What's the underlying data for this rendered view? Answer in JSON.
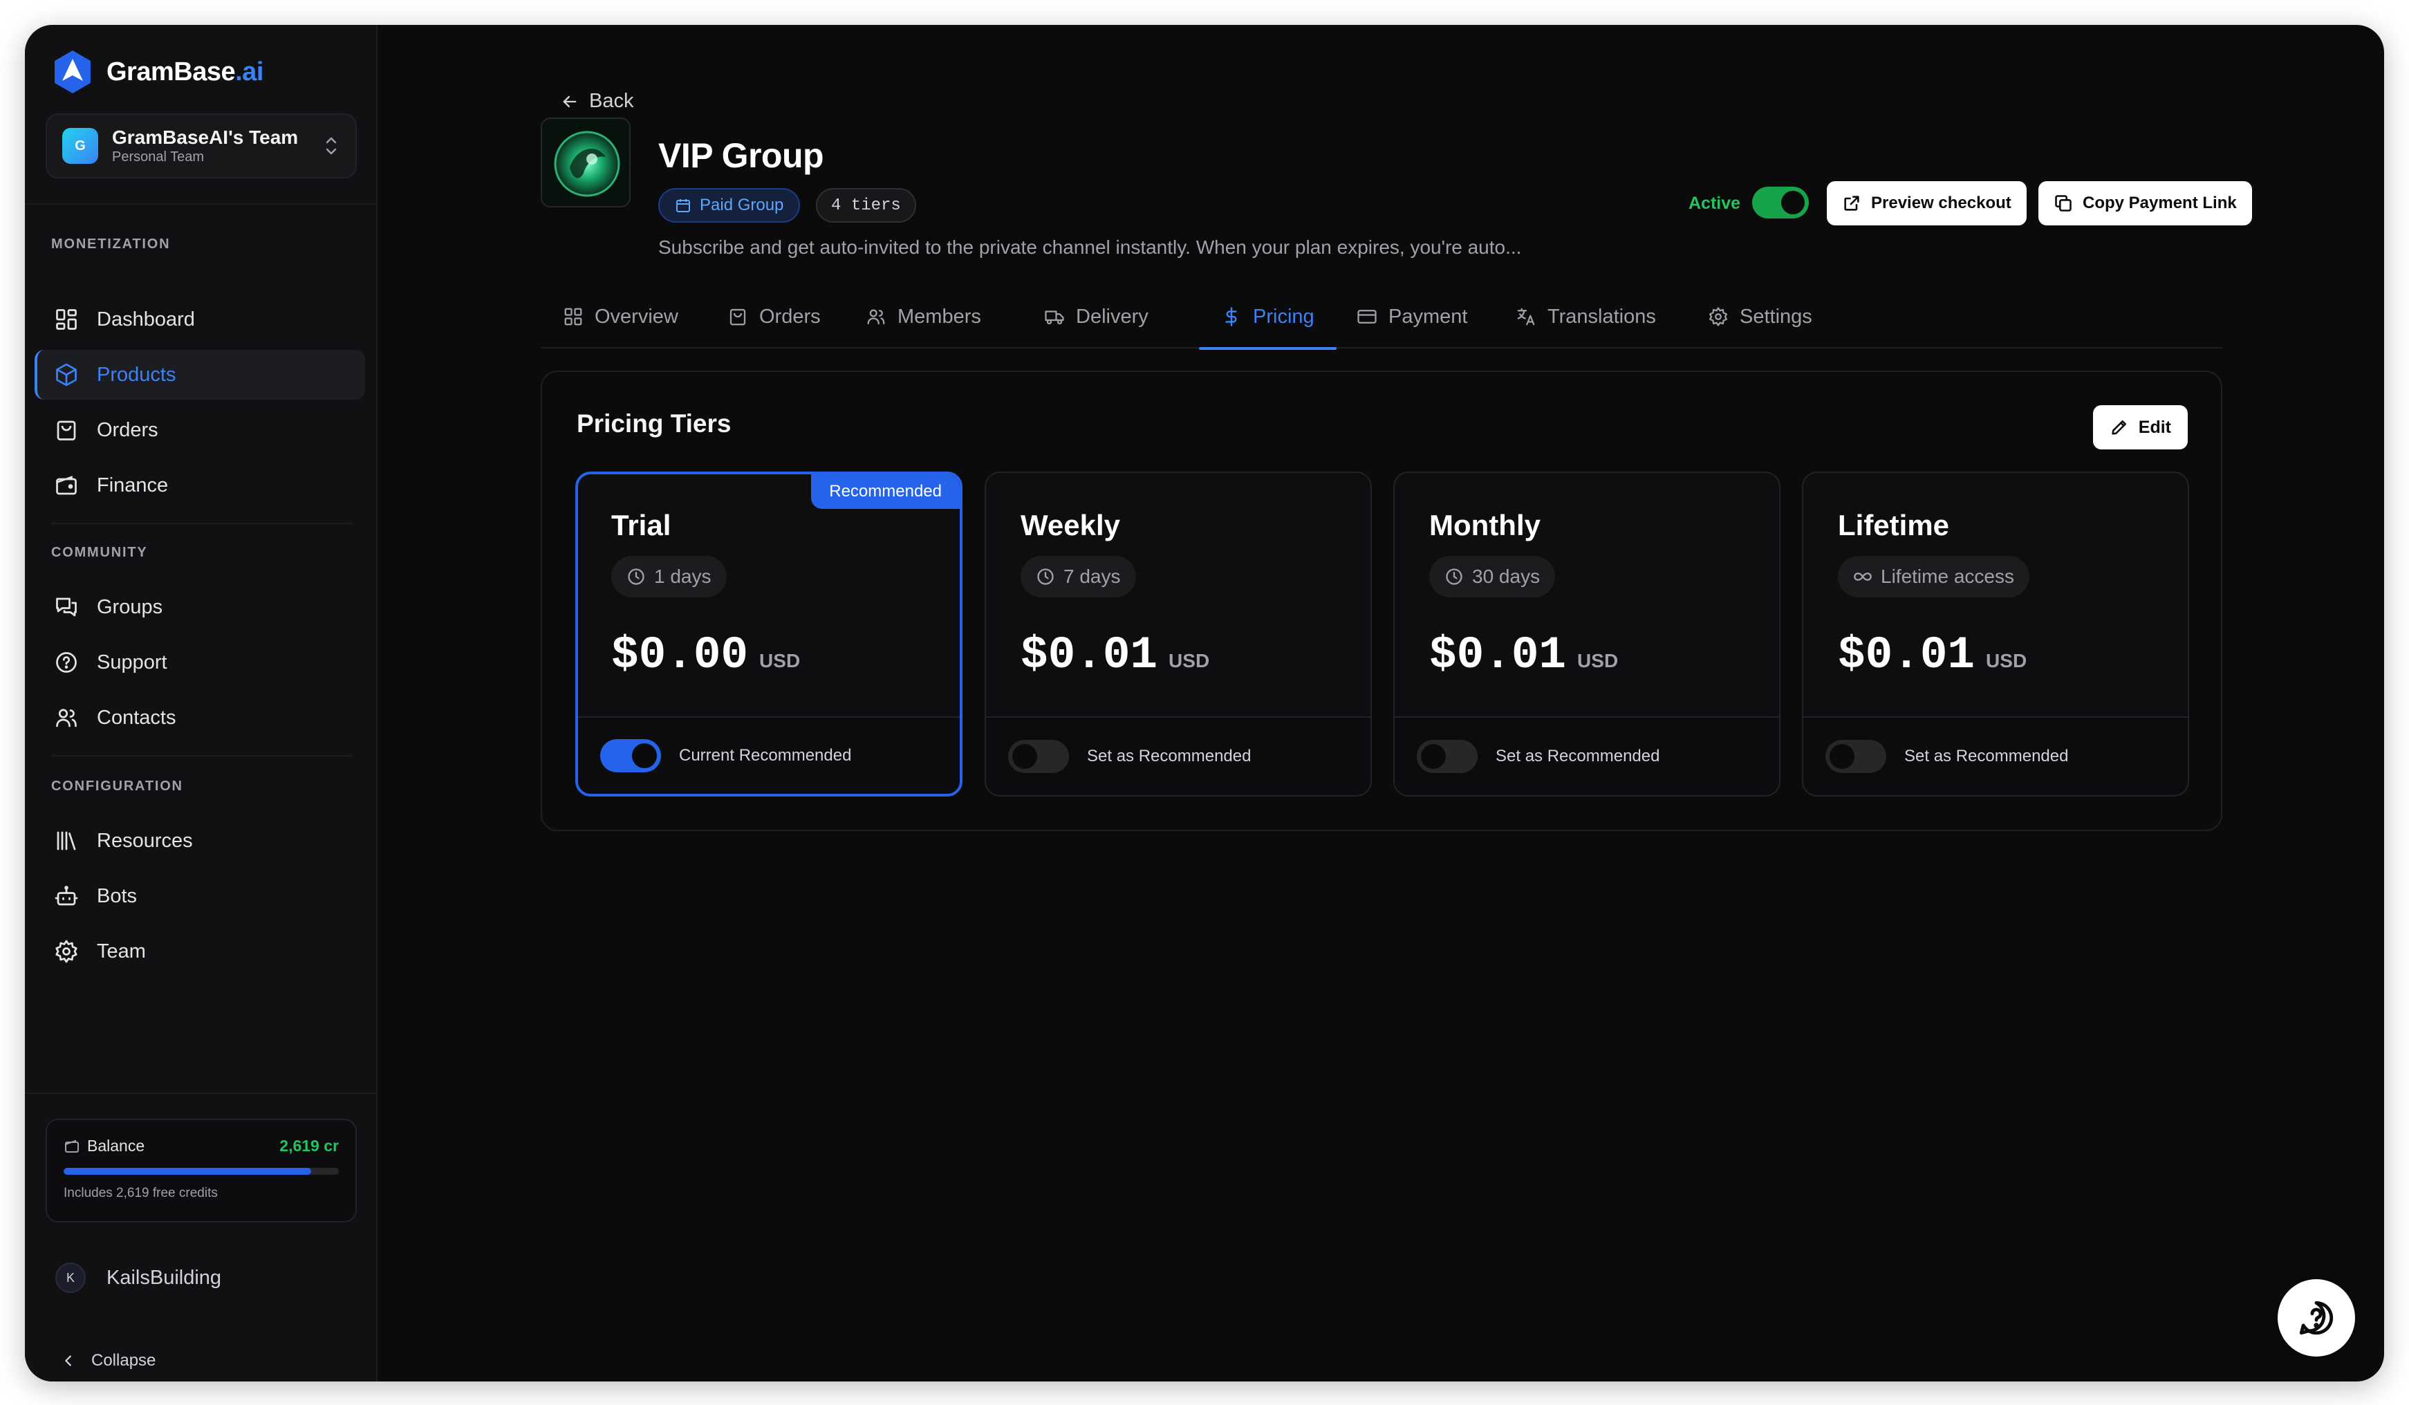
{
  "brand": {
    "name": "GramBase",
    "suffix": ".ai"
  },
  "team": {
    "name": "GramBaseAI's Team",
    "subtitle": "Personal Team",
    "initial": "G"
  },
  "sidebar": {
    "sections": [
      {
        "label": "MONETIZATION",
        "items": [
          {
            "label": "Dashboard",
            "icon": "dashboard-icon"
          },
          {
            "label": "Products",
            "icon": "box-icon",
            "active": true
          },
          {
            "label": "Orders",
            "icon": "shopping-bag-icon"
          },
          {
            "label": "Finance",
            "icon": "wallet-icon"
          }
        ]
      },
      {
        "label": "COMMUNITY",
        "items": [
          {
            "label": "Groups",
            "icon": "chat-icon"
          },
          {
            "label": "Support",
            "icon": "help-circle-icon"
          },
          {
            "label": "Contacts",
            "icon": "users-icon"
          }
        ]
      },
      {
        "label": "CONFIGURATION",
        "items": [
          {
            "label": "Resources",
            "icon": "library-icon"
          },
          {
            "label": "Bots",
            "icon": "bot-icon"
          },
          {
            "label": "Team",
            "icon": "gear-icon"
          }
        ]
      }
    ],
    "balance": {
      "label": "Balance",
      "value": "2,619 cr",
      "fill_fraction": 0.9,
      "note": "Includes 2,619 free credits"
    },
    "user": {
      "initial": "K",
      "name": "KailsBuilding"
    },
    "collapse_label": "Collapse"
  },
  "header": {
    "back_label": "Back",
    "title": "VIP Group",
    "type_chip": "Paid Group",
    "tiers_chip": "4 tiers",
    "description": "Subscribe and get auto-invited to the private channel instantly. When your plan expires, you're auto...",
    "status_label": "Active",
    "status_on": true,
    "preview_label": "Preview checkout",
    "copy_link_label": "Copy Payment Link"
  },
  "tabs": [
    {
      "label": "Overview",
      "icon": "grid-icon"
    },
    {
      "label": "Orders",
      "icon": "shopping-bag-icon"
    },
    {
      "label": "Members",
      "icon": "users-icon"
    },
    {
      "label": "Delivery",
      "icon": "truck-icon"
    },
    {
      "label": "Pricing",
      "icon": "dollar-icon",
      "active": true
    },
    {
      "label": "Payment",
      "icon": "credit-card-icon"
    },
    {
      "label": "Translations",
      "icon": "translate-icon"
    },
    {
      "label": "Settings",
      "icon": "gear-icon"
    }
  ],
  "pricing": {
    "title": "Pricing Tiers",
    "edit_label": "Edit",
    "recommended_badge": "Recommended",
    "tiers": [
      {
        "name": "Trial",
        "duration": "1 days",
        "duration_icon": "clock-icon",
        "amount": "$0.00",
        "currency": "USD",
        "recommended": true,
        "footer_label": "Current Recommended"
      },
      {
        "name": "Weekly",
        "duration": "7 days",
        "duration_icon": "clock-icon",
        "amount": "$0.01",
        "currency": "USD",
        "recommended": false,
        "footer_label": "Set as Recommended"
      },
      {
        "name": "Monthly",
        "duration": "30 days",
        "duration_icon": "clock-icon",
        "amount": "$0.01",
        "currency": "USD",
        "recommended": false,
        "footer_label": "Set as Recommended"
      },
      {
        "name": "Lifetime",
        "duration": "Lifetime access",
        "duration_icon": "infinity-icon",
        "amount": "$0.01",
        "currency": "USD",
        "recommended": false,
        "footer_label": "Set as Recommended"
      }
    ]
  },
  "colors": {
    "accent": "#2563eb",
    "success": "#22c55e",
    "background": "#0b0b0c"
  }
}
